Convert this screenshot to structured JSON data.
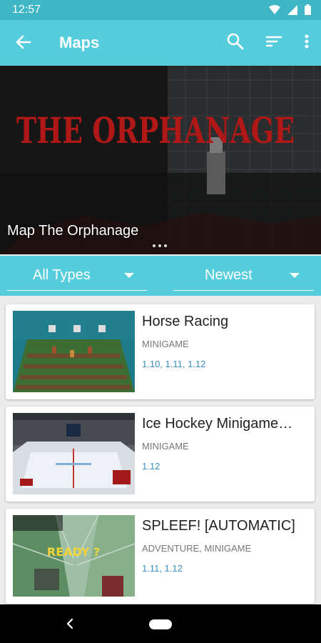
{
  "status": {
    "time": "12:57"
  },
  "appbar": {
    "title": "Maps"
  },
  "hero": {
    "caption": "Map The Orphanage",
    "logo_text": "THE ORPHANAGE"
  },
  "filters": {
    "type_label": "All Types",
    "sort_label": "Newest"
  },
  "maps": [
    {
      "name": "Horse Racing",
      "category": "MINIGAME",
      "versions": "1.10, 1.11, 1.12"
    },
    {
      "name": "Ice Hockey Minigame…",
      "category": "MINIGAME",
      "versions": "1.12"
    },
    {
      "name": "SPLEEF! [AUTOMATIC]",
      "category": "ADVENTURE, MINIGAME",
      "versions": "1.11, 1.12",
      "thumb_text": "READY ?"
    }
  ],
  "colors": {
    "status_bar": "#3fb6c6",
    "app_bar": "#55cddd",
    "version_text": "#3a8fc5",
    "hero_text": "#b01818"
  }
}
